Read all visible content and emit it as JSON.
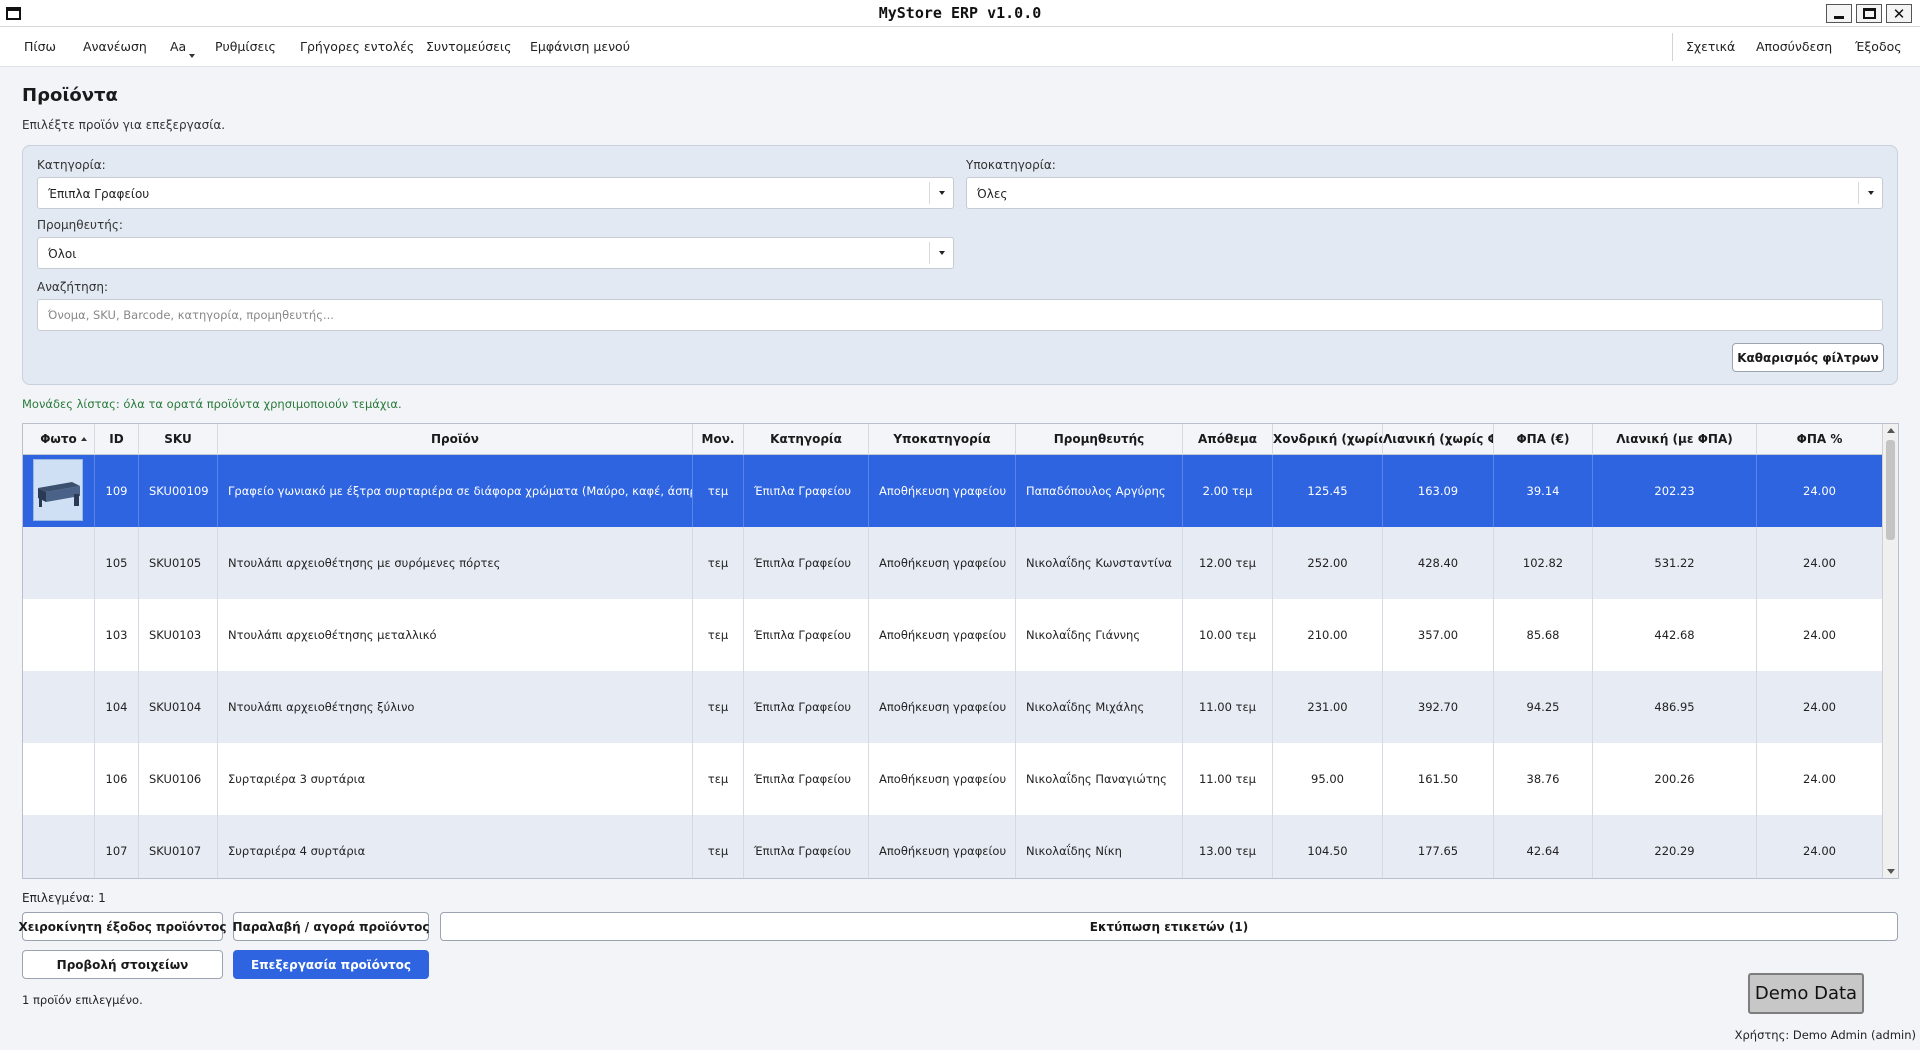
{
  "window": {
    "title": "MyStore ERP v1.0.0"
  },
  "menu": {
    "left": [
      "Πίσω",
      "Ανανέωση",
      "Aa",
      "Ρυθμίσεις",
      "Γρήγορες εντολές",
      "Συντομεύσεις",
      "Εμφάνιση μενού"
    ],
    "right": [
      "Σχετικά",
      "Αποσύνδεση",
      "Έξοδος"
    ]
  },
  "page": {
    "title": "Προϊόντα",
    "subtitle": "Επιλέξτε προϊόν για επεξεργασία."
  },
  "filters": {
    "category_label": "Κατηγορία:",
    "category_value": "Έπιπλα Γραφείου",
    "subcategory_label": "Υποκατηγορία:",
    "subcategory_value": "Όλες",
    "supplier_label": "Προμηθευτής:",
    "supplier_value": "Όλοι",
    "search_label": "Αναζήτηση:",
    "search_placeholder": "Όνομα, SKU, Barcode, κατηγορία, προμηθευτής...",
    "clear_label": "Καθαρισμός φίλτρων"
  },
  "units_note": "Μονάδες λίστας: όλα τα ορατά προϊόντα χρησιμοποιούν τεμάχια.",
  "table": {
    "headers": [
      "Φωτο",
      "ID",
      "SKU",
      "Προϊόν",
      "Μον.",
      "Κατηγορία",
      "Υποκατηγορία",
      "Προμηθευτής",
      "Απόθεμα",
      "Χονδρική (χωρίς ΦΠΑ)",
      "Λιανική (χωρίς ΦΠΑ)",
      "ΦΠΑ (€)",
      "Λιανική (με ΦΠΑ)",
      "ΦΠΑ %"
    ],
    "rows": [
      {
        "id": "109",
        "sku": "SKU00109",
        "name": "Γραφείο γωνιακό με έξτρα συρταριέρα σε διάφορα χρώματα (Μαύρο, καφέ, άσπρο)",
        "unit": "τεμ",
        "category": "Έπιπλα Γραφείου",
        "subcategory": "Αποθήκευση γραφείου",
        "supplier": "Παπαδόπουλος Αργύρης",
        "stock": "2.00 τεμ",
        "wholesale": "125.45",
        "retail": "163.09",
        "vat": "39.14",
        "retail_vat": "202.23",
        "vat_pct": "24.00",
        "selected": true,
        "photo": true
      },
      {
        "id": "105",
        "sku": "SKU0105",
        "name": "Ντουλάπι αρχειοθέτησης με συρόμενες πόρτες",
        "unit": "τεμ",
        "category": "Έπιπλα Γραφείου",
        "subcategory": "Αποθήκευση γραφείου",
        "supplier": "Νικολαΐδης Κωνσταντίνα",
        "stock": "12.00 τεμ",
        "wholesale": "252.00",
        "retail": "428.40",
        "vat": "102.82",
        "retail_vat": "531.22",
        "vat_pct": "24.00",
        "selected": false,
        "photo": false
      },
      {
        "id": "103",
        "sku": "SKU0103",
        "name": "Ντουλάπι αρχειοθέτησης μεταλλικό",
        "unit": "τεμ",
        "category": "Έπιπλα Γραφείου",
        "subcategory": "Αποθήκευση γραφείου",
        "supplier": "Νικολαΐδης Γιάννης",
        "stock": "10.00 τεμ",
        "wholesale": "210.00",
        "retail": "357.00",
        "vat": "85.68",
        "retail_vat": "442.68",
        "vat_pct": "24.00",
        "selected": false,
        "photo": false
      },
      {
        "id": "104",
        "sku": "SKU0104",
        "name": "Ντουλάπι αρχειοθέτησης ξύλινο",
        "unit": "τεμ",
        "category": "Έπιπλα Γραφείου",
        "subcategory": "Αποθήκευση γραφείου",
        "supplier": "Νικολαΐδης Μιχάλης",
        "stock": "11.00 τεμ",
        "wholesale": "231.00",
        "retail": "392.70",
        "vat": "94.25",
        "retail_vat": "486.95",
        "vat_pct": "24.00",
        "selected": false,
        "photo": false
      },
      {
        "id": "106",
        "sku": "SKU0106",
        "name": "Συρταριέρα 3 συρτάρια",
        "unit": "τεμ",
        "category": "Έπιπλα Γραφείου",
        "subcategory": "Αποθήκευση γραφείου",
        "supplier": "Νικολαΐδης Παναγιώτης",
        "stock": "11.00 τεμ",
        "wholesale": "95.00",
        "retail": "161.50",
        "vat": "38.76",
        "retail_vat": "200.26",
        "vat_pct": "24.00",
        "selected": false,
        "photo": false
      },
      {
        "id": "107",
        "sku": "SKU0107",
        "name": "Συρταριέρα 4 συρτάρια",
        "unit": "τεμ",
        "category": "Έπιπλα Γραφείου",
        "subcategory": "Αποθήκευση γραφείου",
        "supplier": "Νικολαΐδης Νίκη",
        "stock": "13.00 τεμ",
        "wholesale": "104.50",
        "retail": "177.65",
        "vat": "42.64",
        "retail_vat": "220.29",
        "vat_pct": "24.00",
        "selected": false,
        "photo": false
      }
    ]
  },
  "footer": {
    "selected_count": "Επιλεγμένα: 1",
    "manual_out": "Χειροκίνητη έξοδος προϊόντος",
    "receive": "Παραλαβή / αγορά προϊόντος",
    "print_labels": "Εκτύπωση ετικετών (1)",
    "view_details": "Προβολή στοιχείων",
    "edit_product": "Επεξεργασία προϊόντος",
    "status": "1 προϊόν επιλεγμένο.",
    "demo": "Demo Data",
    "user": "Χρήστης: Demo Admin (admin)"
  },
  "colors": {
    "accent": "#2e64df",
    "panel": "#e3e9f3",
    "note": "#2a7a3a"
  }
}
